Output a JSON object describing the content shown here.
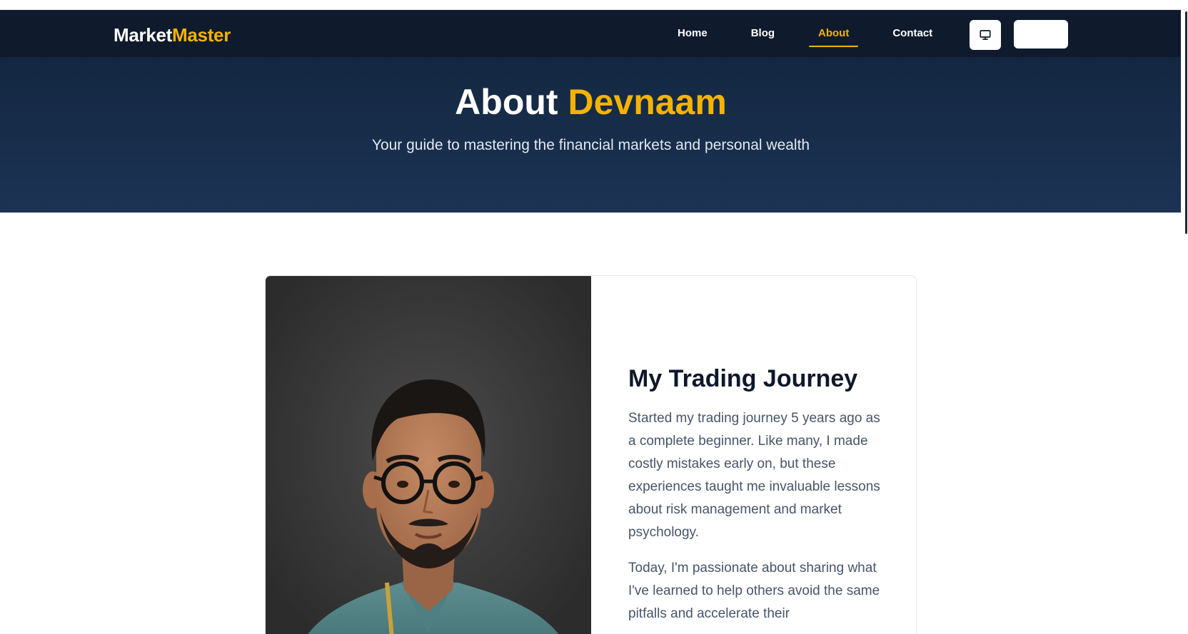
{
  "nav": {
    "logo_part1": "Market",
    "logo_part2": "Master",
    "links": [
      "Home",
      "Blog",
      "About",
      "Contact"
    ],
    "active_link": "About",
    "monitor_icon": "monitor-icon",
    "accent_color": "#f5b301",
    "bg_color": "#0f1b2d"
  },
  "hero": {
    "title_prefix": "About",
    "title_name": "Devnaam",
    "subtitle": "Your guide to mastering the financial markets and personal wealth"
  },
  "about": {
    "heading": "My Trading Journey",
    "paragraph1": "Started my trading journey 5 years ago as a complete beginner. Like many, I made costly mistakes early on, but these experiences taught me invaluable lessons about risk management and market psychology.",
    "paragraph2": "Today, I'm passionate about sharing what I've learned to help others avoid the same pitfalls and accelerate their"
  }
}
